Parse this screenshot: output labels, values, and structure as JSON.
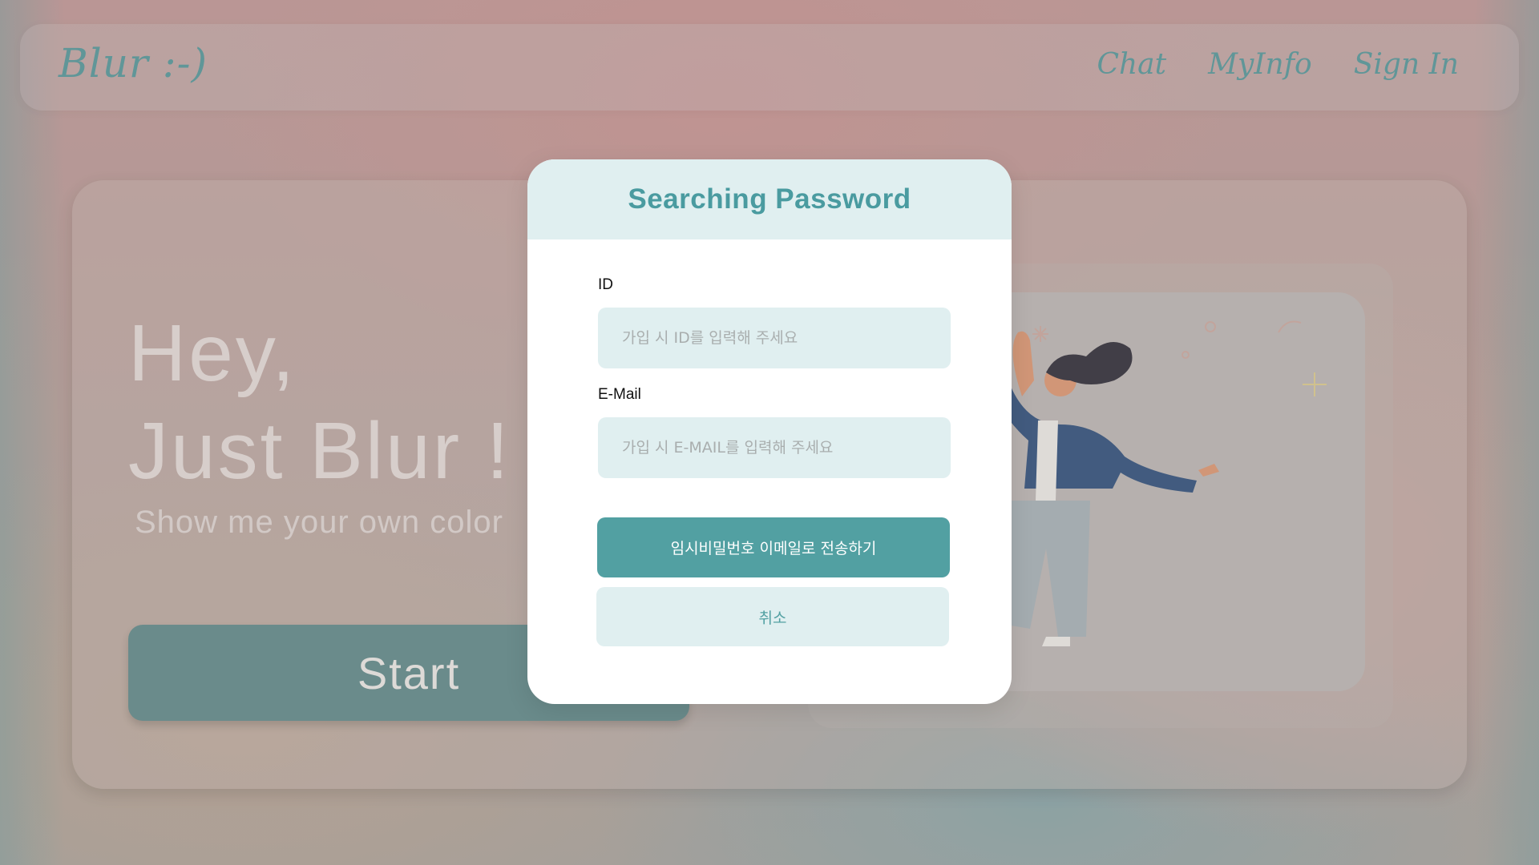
{
  "navbar": {
    "logo": "Blur :-)",
    "links": [
      "Chat",
      "MyInfo",
      "Sign In"
    ]
  },
  "hero": {
    "title_line1": "Hey,",
    "title_line2": "Just Blur !",
    "subtitle": "Show me your own color",
    "start_label": "Start"
  },
  "modal": {
    "title": "Searching Password",
    "id_label": "ID",
    "id_placeholder": "가입 시 ID를 입력해 주세요",
    "email_label": "E-Mail",
    "email_placeholder": "가입 시 E-MAIL를 입력해 주세요",
    "submit_label": "임시비밀번호 이메일로 전송하기",
    "cancel_label": "취소"
  },
  "colors": {
    "accent": "#52a0a2",
    "header_bg": "#e0eff0",
    "logo": "#5f9a9c"
  }
}
